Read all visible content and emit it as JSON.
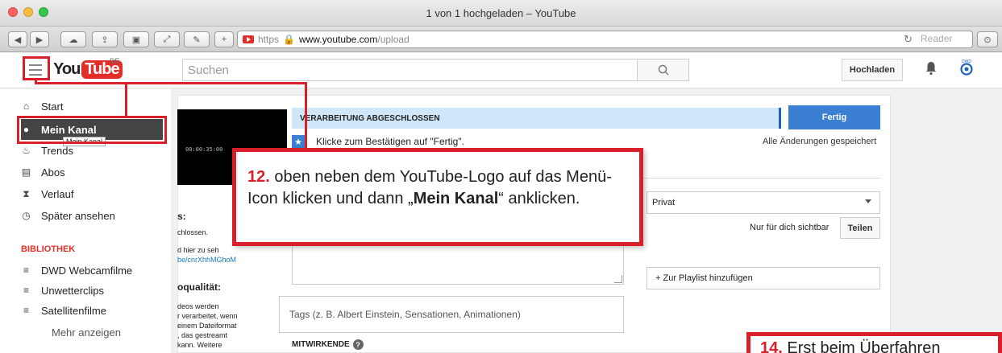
{
  "window": {
    "title": "1 von 1 hochgeladen – YouTube"
  },
  "browser": {
    "url_scheme": "https",
    "url_host": "www.youtube.com",
    "url_path": "/upload",
    "reader_label": "Reader",
    "reload_glyph": "↻"
  },
  "header": {
    "logo_you": "You",
    "logo_tube": "Tube",
    "logo_region": "DE",
    "search_placeholder": "Suchen",
    "upload_label": "Hochladen"
  },
  "sidebar": {
    "items": [
      {
        "label": "Start",
        "icon": "home-icon"
      },
      {
        "label": "Mein Kanal",
        "icon": "user-icon"
      },
      {
        "label": "Trends",
        "icon": "flame-icon"
      },
      {
        "label": "Abos",
        "icon": "subscriptions-icon"
      },
      {
        "label": "Verlauf",
        "icon": "hourglass-icon"
      },
      {
        "label": "Später ansehen",
        "icon": "clock-icon"
      }
    ],
    "tooltip": "Mein Kanal",
    "library_heading": "BIBLIOTHEK",
    "library": [
      {
        "label": "DWD Webcamfilme",
        "icon": "playlist-icon"
      },
      {
        "label": "Unwetterclips",
        "icon": "playlist-icon"
      },
      {
        "label": "Satellitenfilme",
        "icon": "playlist-icon"
      }
    ],
    "more": "Mehr anzeigen"
  },
  "upload": {
    "video_time": "00:00:35:00",
    "status": "VERARBEITUNG ABGESCHLOSSEN",
    "done_label": "Fertig",
    "confirm_text": "Klicke zum Bestätigen auf \"Fertig\".",
    "saved_text": "Alle Änderungen gespeichert",
    "privacy_value": "Privat",
    "privacy_note": "Nur für dich sichtbar",
    "share_label": "Teilen",
    "playlist_label": "+ Zur Playlist hinzufügen",
    "tags_placeholder": "Tags (z. B. Albert Einstein, Sensationen, Animationen)",
    "contributors_label": "MITWIRKENDE",
    "left_col": {
      "heading1": "s:",
      "line1": "chlossen.",
      "line2": "d hier zu seh",
      "link": "be/cnrXhhMGhoM",
      "heading2": "oqualität:",
      "line3": "deos werden",
      "line4": "r verarbeitet, wenn",
      "line5": "einem Dateiformat",
      "line6": ", das gestreamt",
      "line7": "kann. Weitere"
    }
  },
  "annotations": {
    "step12_num": "12.",
    "step12_text1": "oben neben dem YouTube-Logo auf das Menü-Icon klicken und dann „",
    "step12_bold": "Mein Kanal",
    "step12_text2": "“ anklicken.",
    "step14_num": "14.",
    "step14_text": "Erst beim Überfahren"
  },
  "colors": {
    "accent_red": "#d9202a",
    "youtube_red": "#e52d27",
    "blue": "#3a7fd2"
  }
}
